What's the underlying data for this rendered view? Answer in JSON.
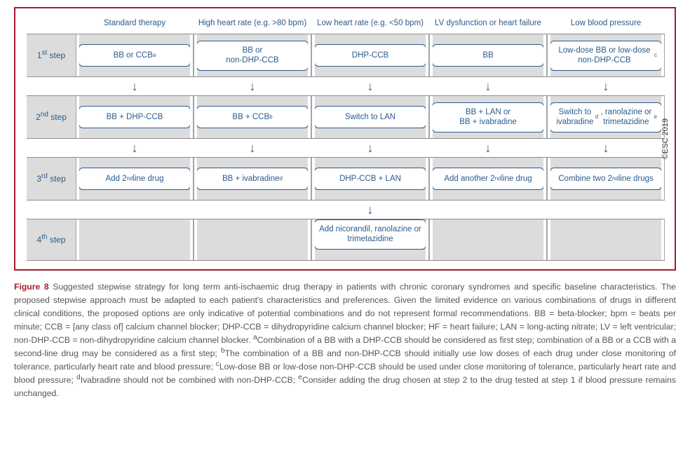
{
  "copyright": "©ESC 2019",
  "columns": [
    {
      "header": "Standard therapy"
    },
    {
      "header": "High heart rate (e.g. >80 bpm)"
    },
    {
      "header": "Low heart rate (e.g. <50 bpm)"
    },
    {
      "header": "LV dysfunction or heart failure"
    },
    {
      "header": "Low blood pressure"
    }
  ],
  "rows": {
    "s1": {
      "label_html": "1<sup>st</sup> step",
      "cells": [
        "BB or CCB<sup>a</sup>",
        "BB or<br>non-DHP-CCB",
        "DHP-CCB",
        "BB",
        "Low-dose BB or low-dose non-DHP-CCB<sup>c</sup>"
      ]
    },
    "s2": {
      "label_html": "2<sup>nd</sup> step",
      "cells": [
        "BB + DHP-CCB",
        "BB + CCB<sup>b</sup>",
        "Switch to LAN",
        "BB + LAN or<br>BB + ivabradine",
        "Switch to ivabradine<sup>d</sup>, ranolazine or trimetazidine<sup>e</sup>"
      ]
    },
    "s3": {
      "label_html": "3<sup>rd</sup> step",
      "cells": [
        "Add 2<sup>nd</sup> line drug",
        "BB + ivabradine<sup>d</sup>",
        "DHP-CCB + LAN",
        "Add another 2<sup>nd</sup> line drug",
        "Combine two 2<sup>nd</sup> line drugs"
      ]
    },
    "s4": {
      "label_html": "4<sup>th</sup> step",
      "cell3": "Add nicorandil, ranolazine or trimetazidine"
    }
  },
  "caption": {
    "label": "Figure 8",
    "text_html": "Suggested stepwise strategy for long term anti-ischaemic drug therapy in patients with chronic coronary syndromes and specific baseline characteristics. The proposed stepwise approach must be adapted to each patient's characteristics and preferences. Given the limited evidence on various combinations of drugs in different clinical conditions, the proposed options are only indicative of potential combinations and do not represent formal recommendations. BB = beta-blocker; bpm = beats per minute; CCB = [any class of] calcium channel blocker; DHP-CCB = dihydropyridine calcium channel blocker; HF = heart failure; LAN = long-acting nitrate; LV = left ventricular; non-DHP-CCB = non-dihydropyridine calcium channel blocker. <sup>a</sup>Combination of a BB with a DHP-CCB should be considered as first step; combination of a BB or a CCB with a second-line drug may be considered as a first step; <sup>b</sup>The combination of a BB and non-DHP-CCB should initially use low doses of each drug under close monitoring of tolerance, particularly heart rate and blood pressure; <sup>c</sup>Low-dose BB or low-dose non-DHP-CCB should be used under close monitoring of tolerance, particularly heart rate and blood pressure; <sup>d</sup>Ivabradine should not be combined with non-DHP-CCB; <sup>e</sup>Consider adding the drug chosen at step 2 to the drug tested at step 1 if blood pressure remains unchanged."
  }
}
